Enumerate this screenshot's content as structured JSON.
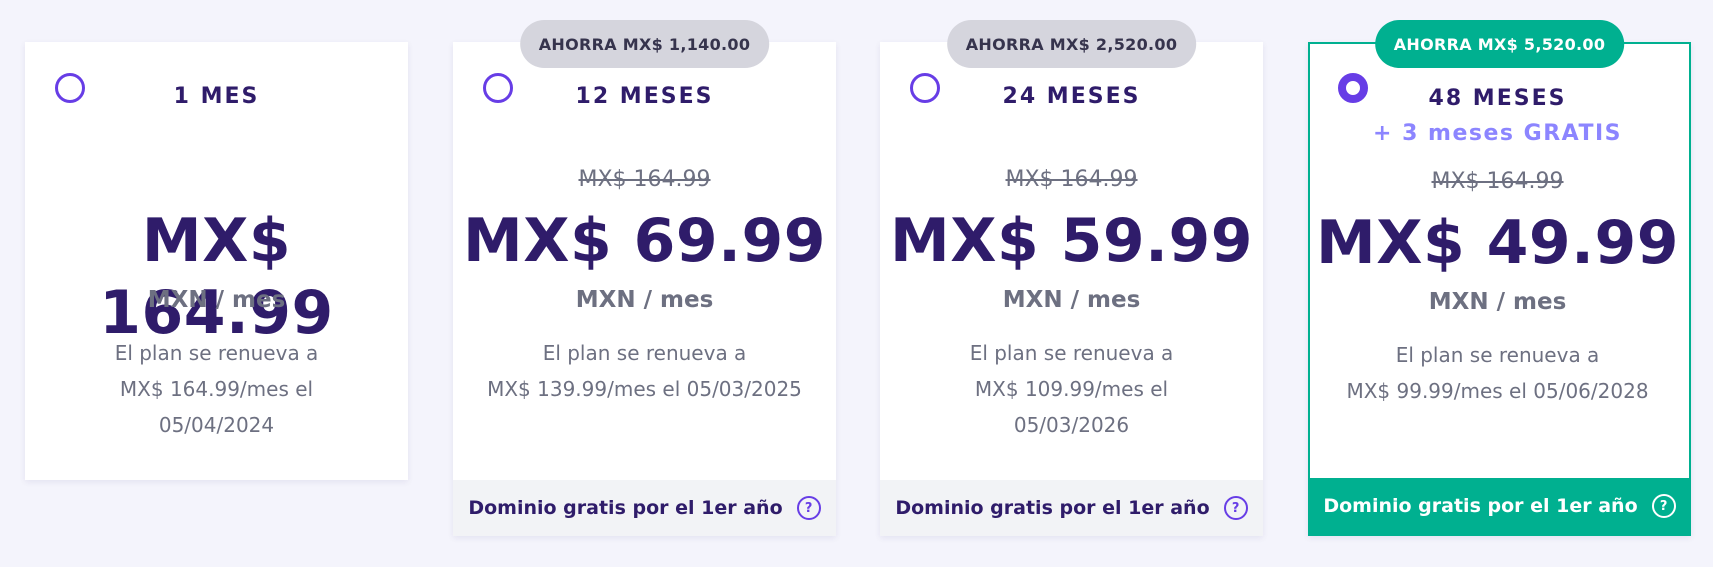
{
  "plans": [
    {
      "period": "1 MES",
      "price": "MX$ 164.99",
      "unit": "MXN / mes",
      "renew_line1": "El plan se renueva a",
      "renew_line2": "MX$ 164.99/mes el",
      "renew_line3": "05/04/2024",
      "selected": false
    },
    {
      "badge": "AHORRA MX$ 1,140.00",
      "period": "12 MESES",
      "old_price": "MX$ 164.99",
      "price": "MX$ 69.99",
      "unit": "MXN / mes",
      "renew_line1": "El plan se renueva a",
      "renew_line2": "MX$ 139.99/mes el 05/03/2025",
      "footer": "Dominio gratis por el 1er año",
      "selected": false
    },
    {
      "badge": "AHORRA MX$ 2,520.00",
      "period": "24 MESES",
      "old_price": "MX$ 164.99",
      "price": "MX$ 59.99",
      "unit": "MXN / mes",
      "renew_line1": "El plan se renueva a",
      "renew_line2": "MX$ 109.99/mes el",
      "renew_line3": "05/03/2026",
      "footer": "Dominio gratis por el 1er año",
      "selected": false
    },
    {
      "badge": "AHORRA MX$ 5,520.00",
      "period": "48 MESES",
      "bonus": "+ 3 meses GRATIS",
      "old_price": "MX$ 164.99",
      "price": "MX$ 49.99",
      "unit": "MXN / mes",
      "renew_line1": "El plan se renueva a",
      "renew_line2": "MX$ 99.99/mes el 05/06/2028",
      "footer": "Dominio gratis por el 1er año",
      "selected": true
    }
  ],
  "help_glyph": "?",
  "colors": {
    "accent": "#673de6",
    "selected_green": "#00b090",
    "heading": "#2f1c6a",
    "bonus": "#8c85ff",
    "muted": "#6d7081"
  },
  "icons": {
    "radio": "radio-button-icon",
    "help": "question-circle-icon"
  }
}
